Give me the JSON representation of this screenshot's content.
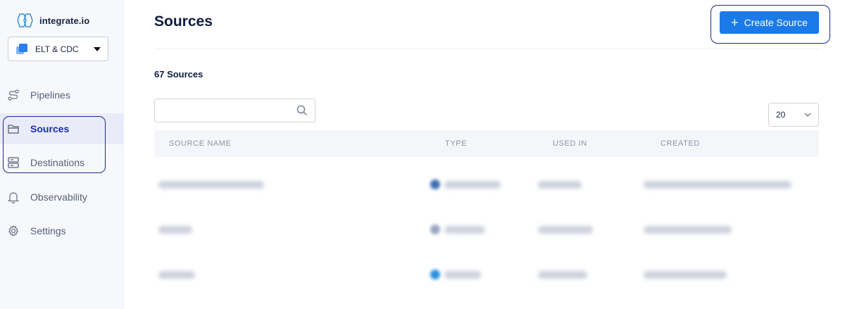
{
  "brand": {
    "name": "integrate.io",
    "accent": "#1a7be8"
  },
  "workspace": {
    "label": "ELT & CDC"
  },
  "nav": [
    {
      "label": "Pipelines",
      "icon": "pipelines-icon"
    },
    {
      "label": "Sources",
      "icon": "folder-icon",
      "active": true
    },
    {
      "label": "Destinations",
      "icon": "database-icon"
    },
    {
      "label": "Observability",
      "icon": "bell-icon"
    },
    {
      "label": "Settings",
      "icon": "gear-icon"
    }
  ],
  "header": {
    "title": "Sources",
    "create_label": "Create Source"
  },
  "list": {
    "count_label": "67 Sources",
    "search_placeholder": "",
    "page_size": "20",
    "columns": [
      "SOURCE NAME",
      "TYPE",
      "USED IN",
      "CREATED"
    ],
    "rows": [
      {
        "type_color": "#3a6fb0"
      },
      {
        "type_color": "#9aa7c0"
      },
      {
        "type_color": "#2b8fe0"
      }
    ]
  }
}
